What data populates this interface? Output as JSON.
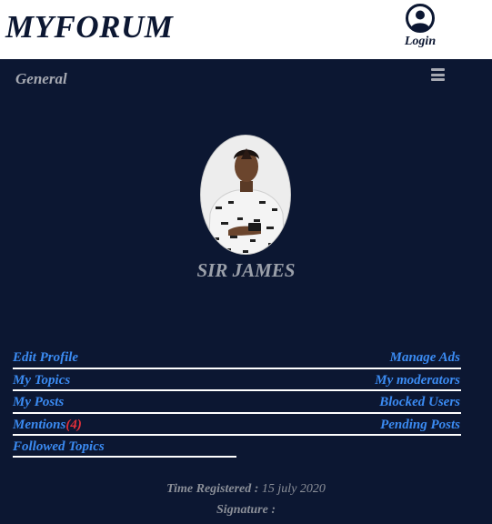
{
  "header": {
    "site_title": "MYFORUM",
    "login_label": "Login"
  },
  "nav": {
    "section_label": "General"
  },
  "profile": {
    "username": "SIR JAMES"
  },
  "links": {
    "edit_profile": "Edit Profile",
    "manage_ads": "Manage Ads",
    "my_topics": "My Topics",
    "my_moderators": "My moderators",
    "my_posts": "My Posts",
    "blocked_users": "Blocked Users",
    "mentions": "Mentions",
    "mentions_count": "(4)",
    "pending_posts": "Pending Posts",
    "followed_topics": "Followed Topics"
  },
  "meta": {
    "time_registered_label": "Time Registered :",
    "time_registered_value": "15 july 2020",
    "signature_label": "Signature :"
  },
  "colors": {
    "background": "#0c1732",
    "link": "#3b8bf2",
    "count": "#e0303a",
    "muted": "#a6a9b2"
  },
  "icons": {
    "login": "user-circle-icon",
    "menu": "hamburger-menu-icon"
  }
}
